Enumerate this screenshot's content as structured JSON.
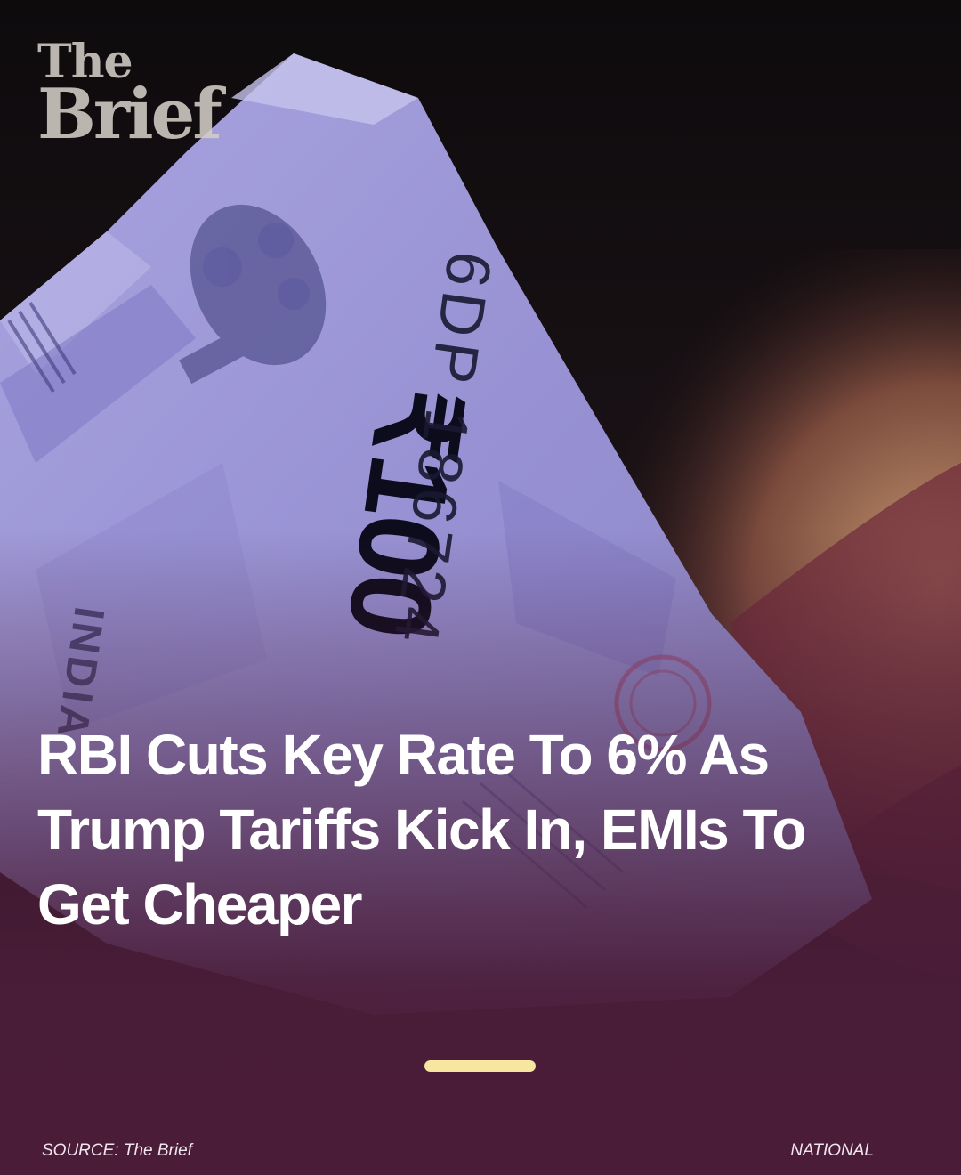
{
  "brand": {
    "logo_line1": "The",
    "logo_line2": "Brief"
  },
  "headline": "RBI Cuts Key Rate To 6% As Trump Tariffs Kick In, EMIs To Get Cheaper",
  "footer": {
    "source": "SOURCE: The Brief",
    "category": "NATIONAL"
  },
  "banknote": {
    "denomination": "₹100",
    "serial": "6DP 186724",
    "country": "INDIA"
  },
  "colors": {
    "background": "#4a1c38",
    "headline_text": "#ffffff",
    "pager_indicator": "#f6e6a0",
    "banknote": "#9c96d8"
  },
  "pager": {
    "active_index": 1,
    "total": 1
  }
}
